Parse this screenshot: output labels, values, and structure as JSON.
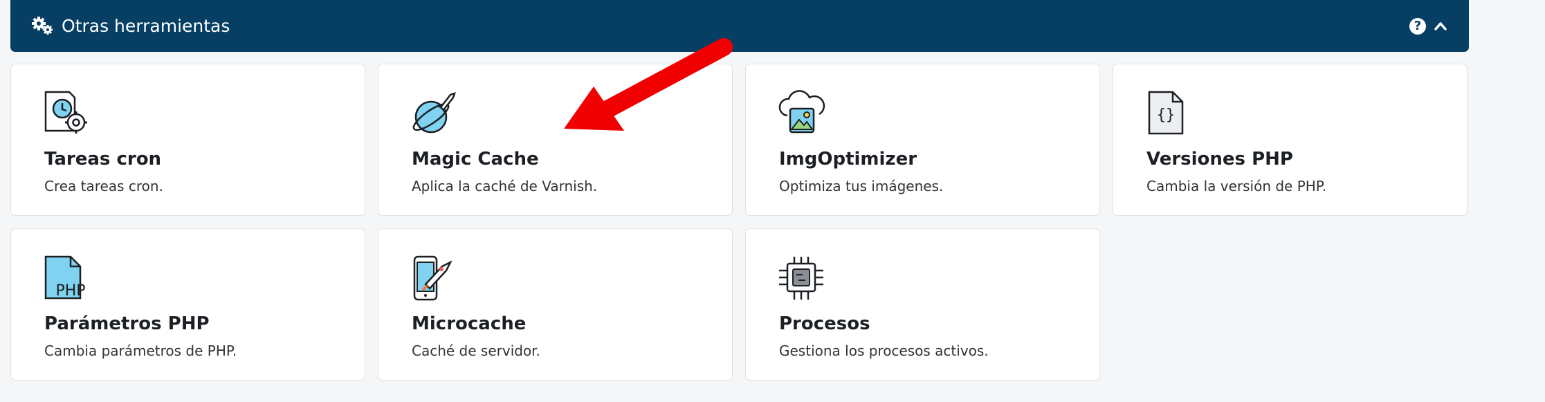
{
  "header": {
    "title": "Otras herramientas",
    "icon": "gears-icon",
    "help_glyph": "?",
    "collapse_icon": "chevron-up-icon"
  },
  "cards": [
    {
      "id": "tareas-cron",
      "title": "Tareas cron",
      "desc": "Crea tareas cron.",
      "icon": "calendar-clock-gear-icon"
    },
    {
      "id": "magic-cache",
      "title": "Magic Cache",
      "desc": "Aplica la caché de Varnish.",
      "icon": "rocket-planet-icon"
    },
    {
      "id": "imgoptimizer",
      "title": "ImgOptimizer",
      "desc": "Optimiza tus imágenes.",
      "icon": "cloud-image-icon"
    },
    {
      "id": "versiones-php",
      "title": "Versiones PHP",
      "desc": "Cambia la versión de PHP.",
      "icon": "code-file-icon"
    },
    {
      "id": "parametros-php",
      "title": "Parámetros PHP",
      "desc": "Cambia parámetros de PHP.",
      "icon": "php-file-icon",
      "icon_text": "PHP"
    },
    {
      "id": "microcache",
      "title": "Microcache",
      "desc": "Caché de servidor.",
      "icon": "phone-rocket-icon"
    },
    {
      "id": "procesos",
      "title": "Procesos",
      "desc": "Gestiona los procesos activos.",
      "icon": "cpu-chip-icon"
    }
  ],
  "colors": {
    "header_bg": "#063f63",
    "arrow": "#f00000",
    "page_bg": "#f5f6f8"
  }
}
